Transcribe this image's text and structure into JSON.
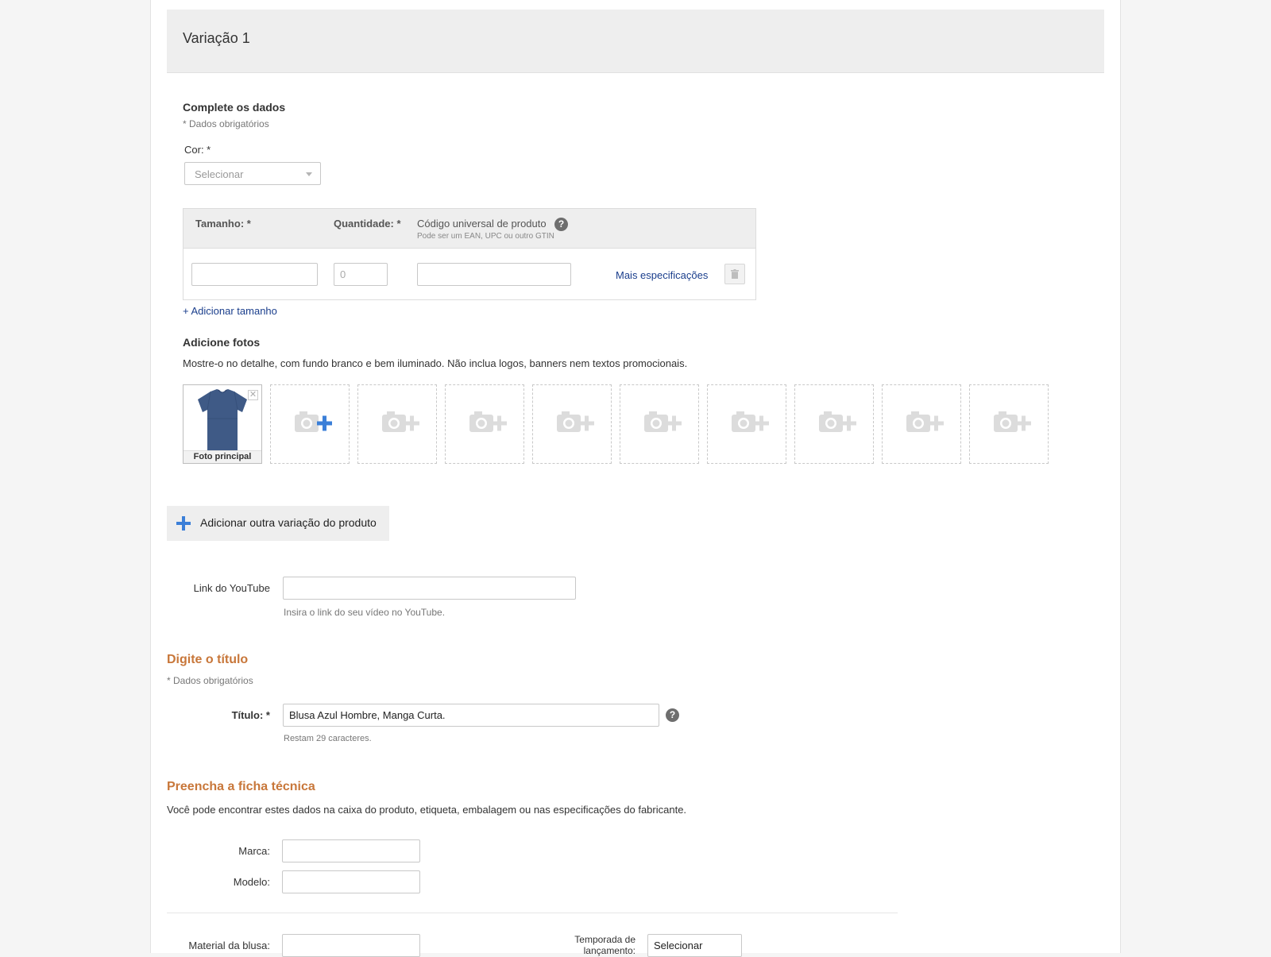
{
  "variation": {
    "title": "Variação 1",
    "complete_heading": "Complete os dados",
    "required_note": "* Dados obrigatórios",
    "color_label": "Cor: *",
    "color_select_value": "Selecionar",
    "size_table": {
      "col_size": "Tamanho: *",
      "col_qty": "Quantidade: *",
      "col_code": "Código universal de produto",
      "col_code_hint": "Pode ser um EAN, UPC ou outro GTIN",
      "row": {
        "size_value": "",
        "qty_placeholder": "0",
        "code_value": ""
      },
      "more_specs": "Mais especificações"
    },
    "add_size": "+ Adicionar tamanho",
    "photos": {
      "heading": "Adicione fotos",
      "hint": "Mostre-o no detalhe, com fundo branco e bem iluminado. Não inclua logos, banners nem textos promocionais.",
      "main_caption": "Foto principal",
      "main_image_icon": "tshirt-icon",
      "empty_slot_icon": "camera-plus-icon",
      "accent_color": "#3b7fd8"
    }
  },
  "add_variation": {
    "label": "Adicionar outra variação do produto",
    "icon": "plus-icon"
  },
  "youtube": {
    "label": "Link do YouTube",
    "value": "",
    "hint": "Insira o link do seu vídeo no YouTube."
  },
  "title_section": {
    "heading": "Digite o título",
    "required_note": "* Dados obrigatórios",
    "label": "Título: *",
    "value": "Blusa Azul Hombre, Manga Curta.",
    "counter": "Restam 29 caracteres."
  },
  "tech_sheet": {
    "heading": "Preencha a ficha técnica",
    "hint": "Você pode encontrar estes dados na caixa do produto, etiqueta, embalagem ou nas especificações do fabricante.",
    "brand_label": "Marca:",
    "model_label": "Modelo:",
    "material_label": "Material da blusa:",
    "season_label_line1": "Temporada de",
    "season_label_line2": "lançamento:",
    "season_select_value": "Selecionar"
  },
  "colors": {
    "section_heading": "#c8773a",
    "link": "#1a3e8c",
    "plus_blue": "#3b7fd8"
  }
}
